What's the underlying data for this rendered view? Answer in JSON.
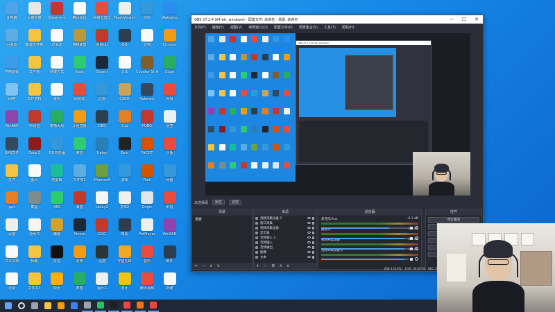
{
  "desktop": {
    "icons": [
      {
        "label": "此电脑",
        "color": "#4fa3e8"
      },
      {
        "label": "百度网盘",
        "color": "#e8e8e8"
      },
      {
        "label": "Steam++",
        "color": "#c0392b"
      },
      {
        "label": "腾讯会议",
        "color": "#ffffff"
      },
      {
        "label": "网易云音乐",
        "color": "#e74c3c"
      },
      {
        "label": "TeamViewer",
        "color": "#ecf0f1"
      },
      {
        "label": "QQ",
        "color": "#3498db"
      },
      {
        "label": "WeGame",
        "color": "#2d8cf0"
      },
      {
        "label": "回收站",
        "color": "#5dade2"
      },
      {
        "label": "新建文件夹",
        "color": "#f5c542"
      },
      {
        "label": "记事本",
        "color": "#fafafa"
      },
      {
        "label": "英雄联盟",
        "color": "#b9973e"
      },
      {
        "label": "网易UU",
        "color": "#c0392b"
      },
      {
        "label": "QQ",
        "color": "#2c3e50"
      },
      {
        "label": "文档",
        "color": "#fafafa"
      },
      {
        "label": "Chrome",
        "color": "#f39c12"
      },
      {
        "label": "控制面板",
        "color": "#3d9be9"
      },
      {
        "label": "文件夹",
        "color": "#f5c542"
      },
      {
        "label": "快捷方式",
        "color": "#fafafa"
      },
      {
        "label": "Xbox",
        "color": "#2ecc71"
      },
      {
        "label": "Steam",
        "color": "#1b2838"
      },
      {
        "label": "文本",
        "color": "#fafafa"
      },
      {
        "label": "Counter-Strike",
        "color": "#7d5e2c"
      },
      {
        "label": "Edge",
        "color": "#27ae60"
      },
      {
        "label": "网络",
        "color": "#7fc4f2"
      },
      {
        "label": "工作资料",
        "color": "#f5c542"
      },
      {
        "label": "说明",
        "color": "#fafafa"
      },
      {
        "label": "网易云",
        "color": "#e74c3c"
      },
      {
        "label": "迅雷",
        "color": "#3498db"
      },
      {
        "label": "CSGO",
        "color": "#c9a35b"
      },
      {
        "label": "Valorant",
        "color": "#34495e"
      },
      {
        "label": "网易",
        "color": "#e74c3c"
      },
      {
        "label": "WinRAR",
        "color": "#8e44ad"
      },
      {
        "label": "YY语音",
        "color": "#c0392b"
      },
      {
        "label": "植物大战",
        "color": "#27ae60"
      },
      {
        "label": "斗鱼直播",
        "color": "#f39c12"
      },
      {
        "label": "OBS",
        "color": "#2c3e50"
      },
      {
        "label": "工具",
        "color": "#e67e22"
      },
      {
        "label": "PUBG",
        "color": "#c0392b"
      },
      {
        "label": "便签",
        "color": "#ecf0f1"
      },
      {
        "label": "RAR文件",
        "color": "#34495e"
      },
      {
        "label": "Dota 2",
        "color": "#8b1c1c"
      },
      {
        "label": "QQ浏览器",
        "color": "#3498db"
      },
      {
        "label": "微信",
        "color": "#2ecc71"
      },
      {
        "label": "Uplay",
        "color": "#2980b9"
      },
      {
        "label": "Epic",
        "color": "#222222"
      },
      {
        "label": "FACEIT",
        "color": "#d35400"
      },
      {
        "label": "斗鱼",
        "color": "#e74c3c"
      },
      {
        "label": "文件",
        "color": "#f5c542"
      },
      {
        "label": "图片",
        "color": "#fafafa"
      },
      {
        "label": "快剪辑",
        "color": "#1abc9c"
      },
      {
        "label": "文件夹2",
        "color": "#5dade2"
      },
      {
        "label": "Minecraft",
        "color": "#6d9f3f"
      },
      {
        "label": "游戏",
        "color": "#3498db"
      },
      {
        "label": "Riot",
        "color": "#d35400"
      },
      {
        "label": "网盘",
        "color": "#3498db"
      },
      {
        "label": "ppt",
        "color": "#e67e22"
      },
      {
        "label": "截图",
        "color": "#7f8c8d"
      },
      {
        "label": "360",
        "color": "#2ecc71"
      },
      {
        "label": "海盗",
        "color": "#c0392b"
      },
      {
        "label": "Uplay2",
        "color": "#f5f5f5"
      },
      {
        "label": "文档2",
        "color": "#ecf0f1"
      },
      {
        "label": "Origin",
        "color": "#dfe6e9"
      },
      {
        "label": "影音",
        "color": "#e74c3c"
      },
      {
        "label": "设置",
        "color": "#ecf0f1"
      },
      {
        "label": "说明书",
        "color": "#f5f5f5"
      },
      {
        "label": "魔兽",
        "color": "#d4a22b"
      },
      {
        "label": "Steam",
        "color": "#1b2838"
      },
      {
        "label": "GOG",
        "color": "#c0392b"
      },
      {
        "label": "暗黑",
        "color": "#2c3e50"
      },
      {
        "label": "PotPlayer",
        "color": "#ecf0f1"
      },
      {
        "label": "WinRAR",
        "color": "#8e44ad"
      },
      {
        "label": "文本文档",
        "color": "#fafafa"
      },
      {
        "label": "相册",
        "color": "#f5c542"
      },
      {
        "label": "抖音",
        "color": "#111111"
      },
      {
        "label": "原神",
        "color": "#f39c12"
      },
      {
        "label": "迅游",
        "color": "#2d3436"
      },
      {
        "label": "守望先锋",
        "color": "#f5a623"
      },
      {
        "label": "音乐",
        "color": "#e74c3c"
      },
      {
        "label": "邮件",
        "color": "#2c3e50"
      },
      {
        "label": "记录",
        "color": "#fafafa"
      },
      {
        "label": "文件夹3",
        "color": "#f5c542"
      },
      {
        "label": "快手",
        "color": "#ffb000"
      },
      {
        "label": "表格",
        "color": "#27ae60"
      },
      {
        "label": "图片2",
        "color": "#ecf0f1"
      },
      {
        "label": "虎牙",
        "color": "#f1c40f"
      },
      {
        "label": "腾讯视频",
        "color": "#e74c3c"
      },
      {
        "label": "新建",
        "color": "#fafafa"
      }
    ]
  },
  "obs": {
    "title": "OBS 27.2.4 (64-bit, windows) - 配置文件: 未命名 - 场景: 未命名",
    "win_min": "─",
    "win_max": "☐",
    "win_close": "✕",
    "menu": [
      "文件(F)",
      "编辑(E)",
      "视图(V)",
      "停靠窗口(D)",
      "配置文件(P)",
      "场景集合(S)",
      "工具(T)",
      "帮助(H)"
    ],
    "toolbar": {
      "label": "未选择源",
      "properties": "属性",
      "filters": "滤镜"
    },
    "inner_title": "OBS 27.2.4 (64-bit, windows)",
    "scenes": {
      "header": "场景",
      "items": [
        "场景"
      ]
    },
    "sources": {
      "header": "来源",
      "items": [
        "视频采集设备 2",
        "窗口采集",
        "视频采集设备",
        "显示器",
        "音频输入 2",
        "音频输入",
        "音频输出",
        "图像",
        "文本"
      ]
    },
    "mixer": {
      "header": "混音器",
      "channels": [
        {
          "name": "麦克风/Aux",
          "db": "-6.1 dB",
          "level": 0.78
        },
        {
          "name": "摄像头",
          "db": "0.0 dB",
          "level": 0.95
        },
        {
          "name": "视频采集设备",
          "db": "0.0 dB",
          "level": 0.95
        },
        {
          "name": "视频采集设备 2",
          "db": "0.0 dB",
          "level": 0.95
        }
      ]
    },
    "controls": {
      "header": "控件",
      "buttons": [
        "停止推流",
        "开始录制",
        "启动虚拟摄像机",
        "工作室模式",
        "设置",
        "退出"
      ]
    },
    "status": {
      "dropped": "丢帧 0 (0.0%)",
      "live": "LIVE: 00:00:00",
      "rec": "REC: 00:00:00",
      "cpu": "CPU: 2.0%, 60.00 fps"
    }
  },
  "foot_symbols": {
    "add": "+",
    "remove": "−",
    "up": "∧",
    "down": "∨",
    "settings": "⚙"
  },
  "taskbar": {
    "icons": [
      {
        "name": "windows",
        "color": "#60a5fa"
      },
      {
        "name": "search",
        "color": "#e5e7eb"
      },
      {
        "name": "task-view",
        "color": "#9ca3af"
      },
      {
        "name": "file-explorer",
        "color": "#f5c542"
      },
      {
        "name": "chrome",
        "color": "#f59e0b"
      },
      {
        "name": "qq",
        "color": "#3b82f6"
      },
      {
        "name": "steam",
        "color": "#9ca3af"
      },
      {
        "name": "wechat",
        "color": "#22c55e"
      },
      {
        "name": "obs",
        "color": "#1f1f1f"
      },
      {
        "name": "netease-music",
        "color": "#ef4444"
      },
      {
        "name": "douyu",
        "color": "#f97316"
      },
      {
        "name": "app",
        "color": "#ef4444"
      }
    ]
  }
}
